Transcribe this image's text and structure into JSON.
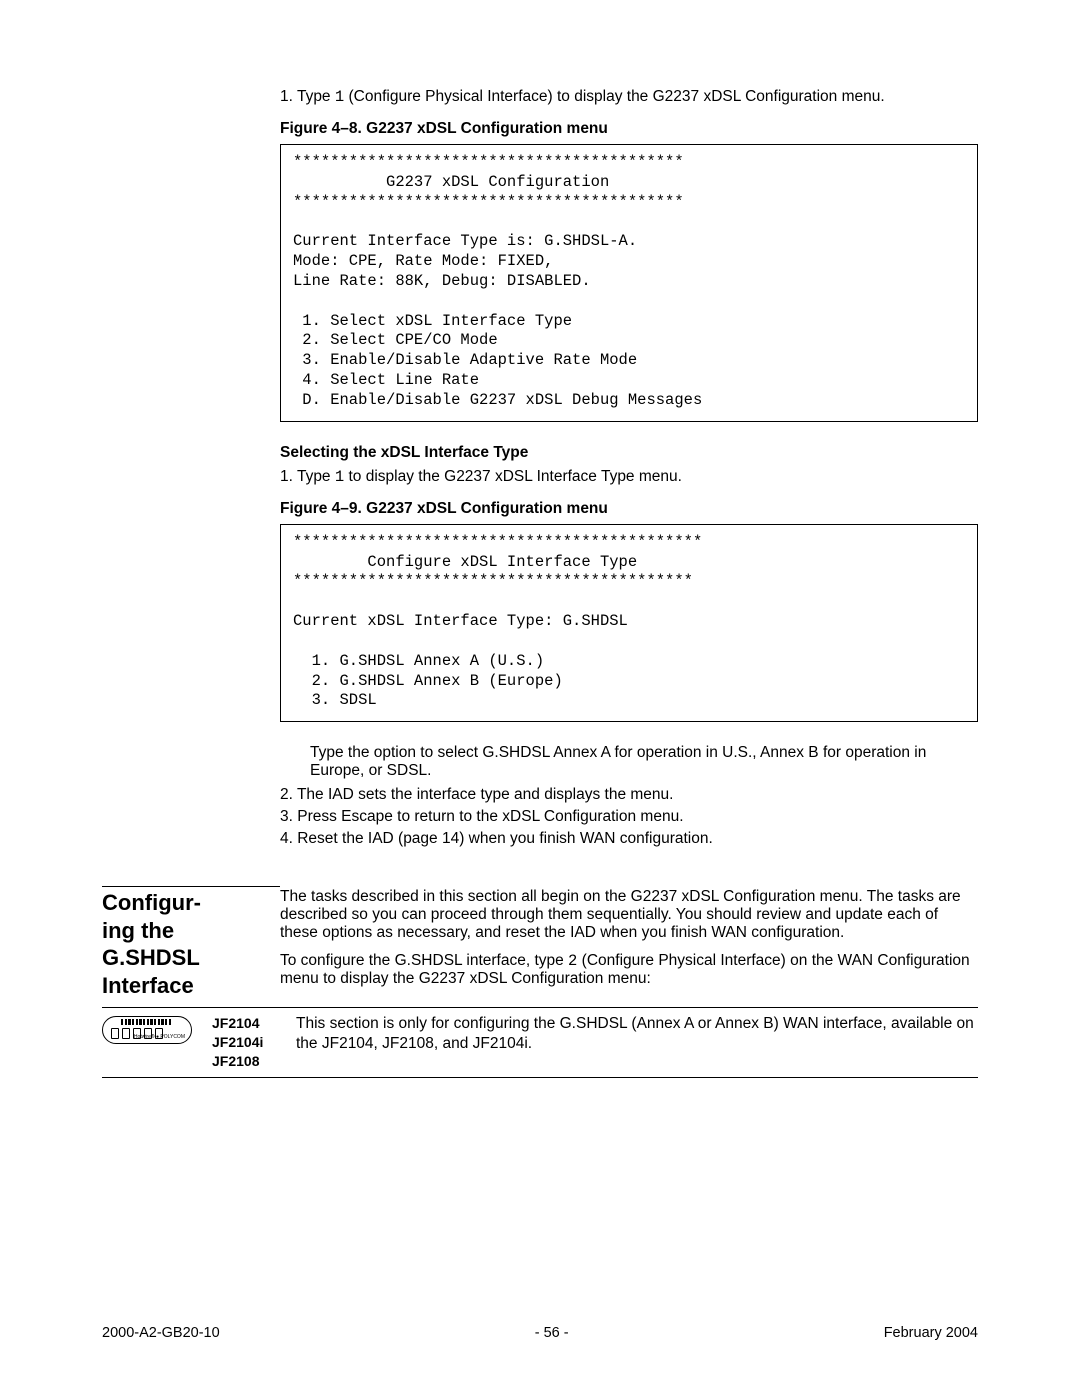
{
  "step1_intro": {
    "prefix": "1.  Type ",
    "code": "1",
    "suffix": " (Configure Physical Interface) to display the G2237 xDSL Configuration menu."
  },
  "fig48_caption": "Figure 4–8.  G2237 xDSL Configuration menu",
  "fig48_code": "******************************************\n          G2237 xDSL Configuration\n******************************************\n\nCurrent Interface Type is: G.SHDSL-A.\nMode: CPE, Rate Mode: FIXED,\nLine Rate: 88K, Debug: DISABLED.\n\n 1. Select xDSL Interface Type\n 2. Select CPE/CO Mode\n 3. Enable/Disable Adaptive Rate Mode\n 4. Select Line Rate\n D. Enable/Disable G2237 xDSL Debug Messages",
  "sub_select_heading": "Selecting the xDSL Interface Type",
  "sub_select_step": {
    "prefix": "1.  Type ",
    "code": "1",
    "suffix": " to display the G2237 xDSL Interface Type menu."
  },
  "fig49_caption": "Figure 4–9.  G2237 xDSL Configuration menu",
  "fig49_code": "********************************************\n        Configure xDSL Interface Type\n*******************************************\n\nCurrent xDSL Interface Type: G.SHDSL\n\n  1. G.SHDSL Annex A (U.S.)\n  2. G.SHDSL Annex B (Europe)\n  3. SDSL",
  "after49_para": "Type the option to select G.SHDSL Annex A for operation in U.S., Annex B for operation in Europe, or SDSL.",
  "after49_item2": "2.   The IAD sets the interface type and displays the menu.",
  "after49_item3": "3.   Press Escape to return to the xDSL Configuration menu.",
  "after49_item4": "4.   Reset the IAD (page 14) when you finish WAN configuration.",
  "side_heading": "Configur-\ning the G.SHDSL Interface",
  "section_para1": "The tasks described in this section all begin on the G2237 xDSL Configuration menu. The tasks are described so you can proceed through them sequentially. You should review and update each of these options as necessary, and reset the IAD when you finish WAN configuration.",
  "section_para2": {
    "prefix": "To configure the G.SHDSL interface, type ",
    "code": "2",
    "suffix": " (Configure Physical Interface) on the WAN Configuration menu to display the G2237 xDSL Configuration menu:"
  },
  "note_models": [
    "JF2104",
    "JF2104i",
    "JF2108"
  ],
  "note_text": "This section is only for configuring the G.SHDSL (Annex A or Annex B) WAN interface, available on the JF2104, JF2108, and JF2104i.",
  "footer_left": "2000-A2-GB20-10",
  "footer_center": "- 56 -",
  "footer_right": "February 2004"
}
